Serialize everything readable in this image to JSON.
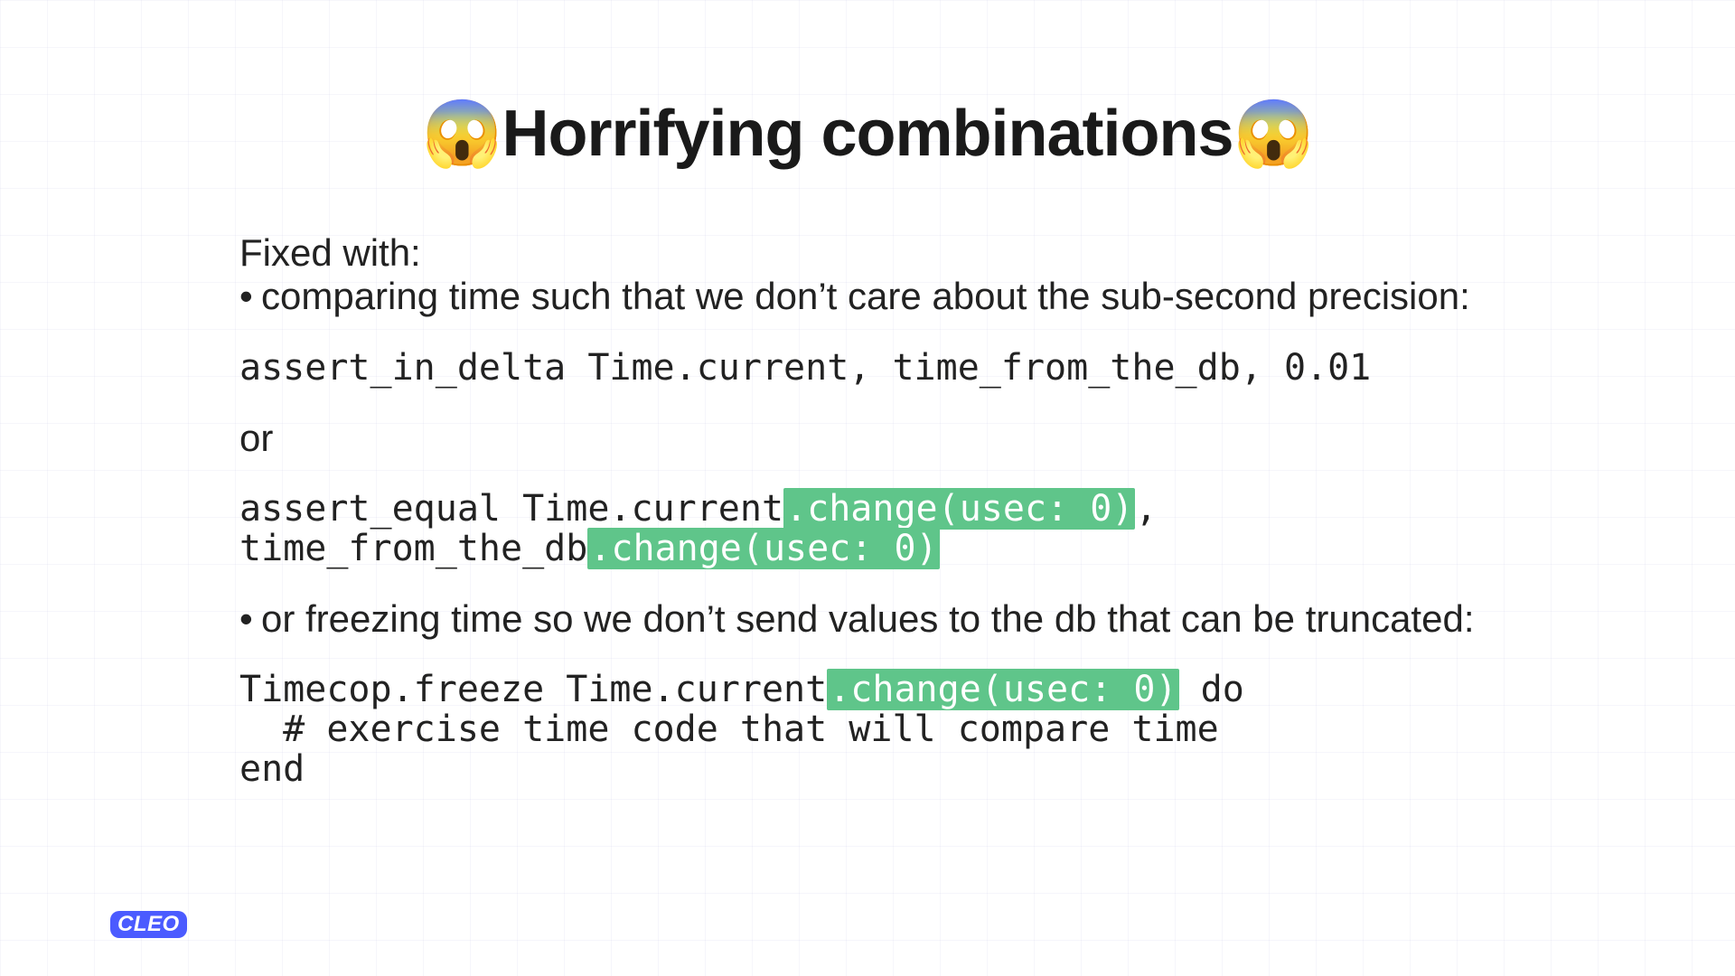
{
  "title_emoji": "😱",
  "title_text": "Horrifying combinations",
  "intro": "Fixed with:",
  "bullet1": "comparing time such that we don’t care about the sub-second precision:",
  "code1": "assert_in_delta Time.current, time_from_the_db, 0.01",
  "or_label": "or",
  "code2_pre1": "assert_equal Time.current",
  "code2_hl1": ".change(usec: 0)",
  "code2_post1": ",",
  "code2_pre2": "time_from_the_db",
  "code2_hl2": ".change(usec: 0)",
  "bullet2": "or freezing time so we don’t send values to the db that can be truncated:",
  "code3_pre": "Timecop.freeze Time.current",
  "code3_hl": ".change(usec: 0)",
  "code3_post": " do",
  "code3_line2": "  # exercise time code that will compare time",
  "code3_line3": "end",
  "logo": "CLEO"
}
